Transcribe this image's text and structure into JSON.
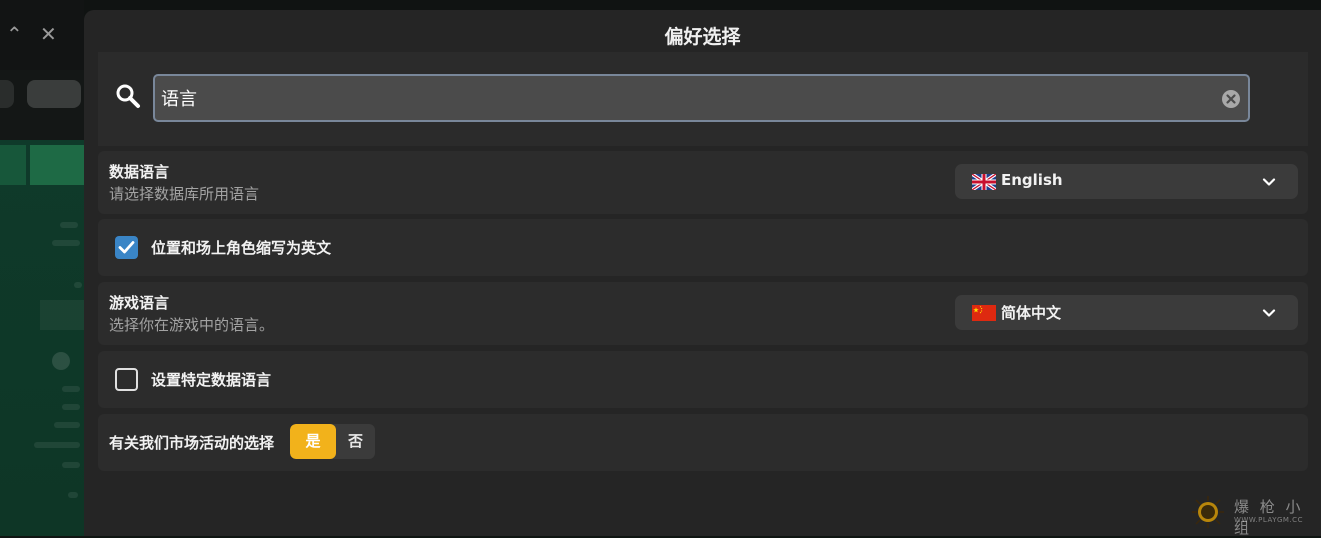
{
  "dialog": {
    "title": "偏好选择"
  },
  "search": {
    "value": "语言",
    "placeholder": ""
  },
  "settings": {
    "data_language": {
      "title": "数据语言",
      "subtitle": "请选择数据库所用语言",
      "selected": "English",
      "flag": "uk-flag-icon"
    },
    "abbreviate_positions": {
      "label": "位置和场上角色缩写为英文",
      "checked": true
    },
    "game_language": {
      "title": "游戏语言",
      "subtitle": "选择你在游戏中的语言。",
      "selected": "简体中文",
      "flag": "china-flag-icon"
    },
    "specific_data_language": {
      "label": "设置特定数据语言",
      "checked": false
    },
    "marketing": {
      "label": "有关我们市场活动的选择",
      "yes_label": "是",
      "no_label": "否",
      "selected": "是"
    }
  },
  "colors": {
    "accent_yes": "#f2b21b",
    "checkbox_checked": "#3a85c6",
    "dialog_bg": "#252525",
    "row_bg": "#2c2c2c",
    "select_bg": "#3b3b3b"
  },
  "watermark": {
    "title": "爆 枪 小 组",
    "url": "WWW.PLAYGM.CC"
  }
}
